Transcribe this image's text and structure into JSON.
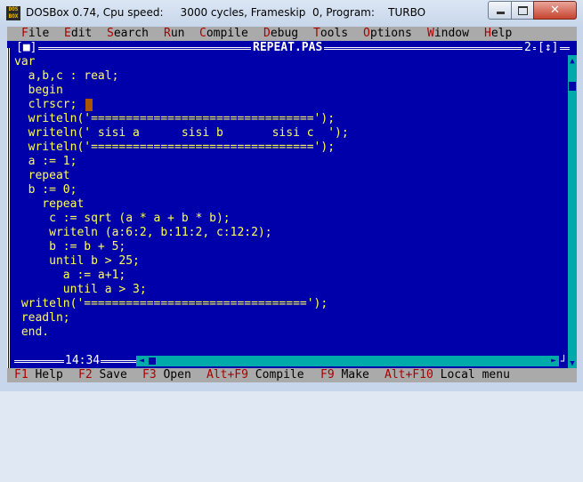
{
  "window": {
    "title": "DOSBox 0.74, Cpu speed:     3000 cycles, Frameskip  0, Program:    TURBO",
    "icon": "dosbox-icon"
  },
  "menu": {
    "items": [
      {
        "hotkey": "F",
        "rest": "ile"
      },
      {
        "hotkey": "E",
        "rest": "dit"
      },
      {
        "hotkey": "S",
        "rest": "earch"
      },
      {
        "hotkey": "R",
        "rest": "un"
      },
      {
        "hotkey": "C",
        "rest": "ompile"
      },
      {
        "hotkey": "D",
        "rest": "ebug"
      },
      {
        "hotkey": "T",
        "rest": "ools"
      },
      {
        "hotkey": "O",
        "rest": "ptions"
      },
      {
        "hotkey": "W",
        "rest": "indow"
      },
      {
        "hotkey": "H",
        "rest": "elp"
      }
    ]
  },
  "editor": {
    "filename": "REPEAT.PAS",
    "window_number": "2",
    "close_box": "[■]",
    "zoom_box": "[↕]",
    "cursor_position": "14:34",
    "lines": [
      "var",
      "  a,b,c : real;",
      "  begin",
      "  clrscr;",
      "  writeln('================================');",
      "  writeln(' sisi a      sisi b       sisi c  ');",
      "  writeln('================================');",
      "  a := 1;",
      "  repeat",
      "  b := 0;",
      "    repeat",
      "     c := sqrt (a * a + b * b);",
      "     writeln (a:6:2, b:11:2, c:12:2);",
      "     b := b + 5;",
      "     until b > 25;",
      "       a := a+1;",
      "       until a > 3;",
      " writeln('================================');",
      " readln;",
      " end."
    ]
  },
  "status": {
    "items": [
      {
        "key": "F1",
        "label": " Help"
      },
      {
        "key": "F2",
        "label": " Save"
      },
      {
        "key": "F3",
        "label": " Open"
      },
      {
        "key": "Alt+F9",
        "label": " Compile"
      },
      {
        "key": "F9",
        "label": " Make"
      },
      {
        "key": "Alt+F10",
        "label": " Local menu"
      }
    ]
  }
}
